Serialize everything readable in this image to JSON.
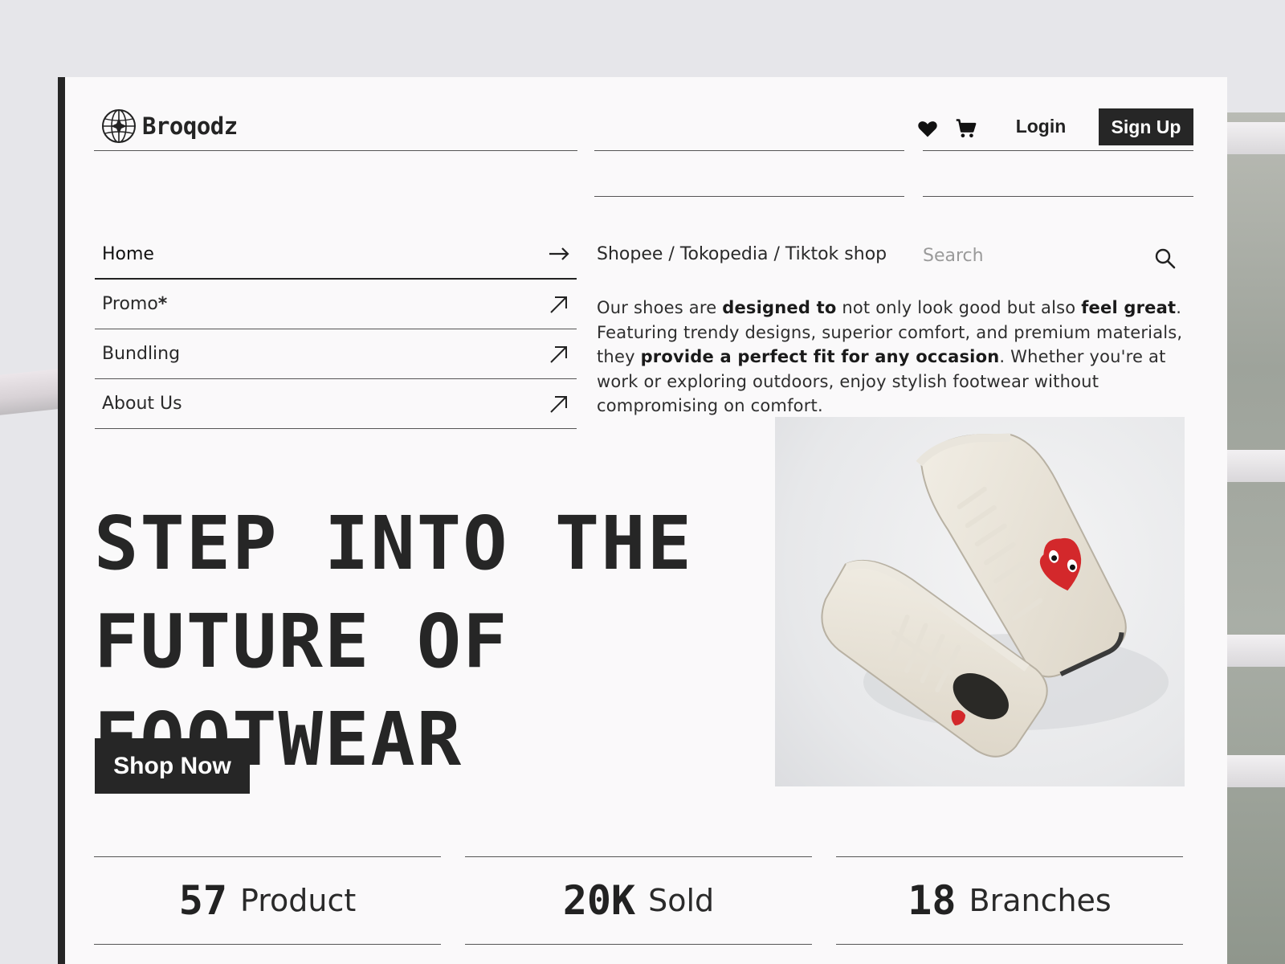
{
  "brand": {
    "name": "Broqodz",
    "logo_icon": "globe-icon"
  },
  "header": {
    "icons": [
      "heart-icon",
      "cart-icon"
    ],
    "login_label": "Login",
    "signup_label": "Sign Up"
  },
  "nav": {
    "items": [
      {
        "label": "Home",
        "marker": "",
        "icon": "arrow-right-icon",
        "active": true
      },
      {
        "label": "Promo",
        "marker": "*",
        "icon": "arrow-up-right-icon",
        "active": false
      },
      {
        "label": "Bundling",
        "marker": "",
        "icon": "arrow-up-right-icon",
        "active": false
      },
      {
        "label": "About Us",
        "marker": "",
        "icon": "arrow-up-right-icon",
        "active": false
      }
    ]
  },
  "marketplaces": {
    "list": [
      "Shopee",
      "Tokopedia",
      "Tiktok shop"
    ],
    "separator": " / "
  },
  "search": {
    "placeholder": "Search",
    "value": ""
  },
  "description": {
    "parts": [
      {
        "text": "Our shoes are ",
        "bold": false
      },
      {
        "text": "designed to",
        "bold": true
      },
      {
        "text": " not only look good but also ",
        "bold": false
      },
      {
        "text": "feel great",
        "bold": true
      },
      {
        "text": ". Featuring trendy designs, superior comfort, and premium materials, they ",
        "bold": false
      },
      {
        "text": "provide a perfect fit for any occasion",
        "bold": true
      },
      {
        "text": ". Whether you're at work or exploring outdoors, enjoy stylish footwear without compromising on comfort.",
        "bold": false
      }
    ]
  },
  "hero": {
    "title_lines": [
      "STEP INTO THE",
      "FUTURE OF",
      "FOOTWEAR"
    ],
    "cta_label": "Shop Now"
  },
  "stats": [
    {
      "value": "57",
      "label": "Product"
    },
    {
      "value": "20K",
      "label": "Sold"
    },
    {
      "value": "18",
      "label": "Branches"
    }
  ],
  "colors": {
    "dark": "#262626",
    "card_bg": "#faf9fa",
    "accent_red": "#d3282b"
  }
}
